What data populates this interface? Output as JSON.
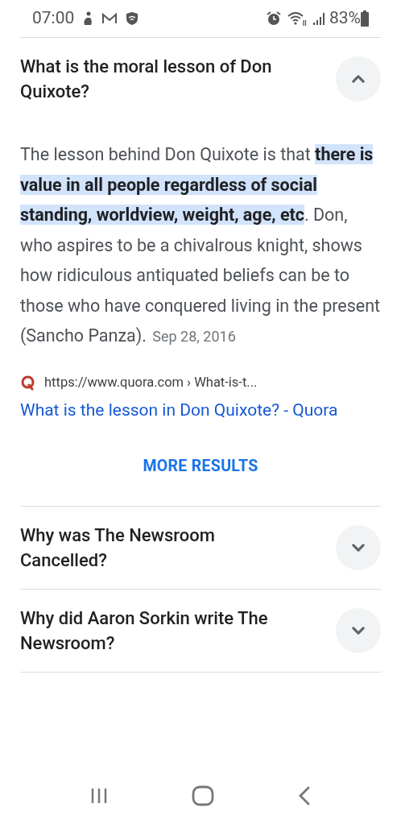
{
  "status_bar": {
    "time": "07:00",
    "battery": "83%"
  },
  "expanded_question": {
    "question": "What is the moral lesson of Don Quixote?",
    "expanded": true,
    "answer": {
      "text_before": "The lesson behind Don Quixote is that ",
      "highlight": "there is value in all people regardless of social standing, worldview, weight, age, etc",
      "text_after": ". Don, who aspires to be a chivalrous knight, shows how ridiculous antiquated beliefs can be to those who have conquered living in the present (Sancho Panza).",
      "date": "Sep 28, 2016"
    },
    "source": {
      "url": "https://www.quora.com › What-is-t...",
      "title": "What is the lesson in Don Quixote? - Quora"
    }
  },
  "more_results": "MORE RESULTS",
  "questions": [
    {
      "question": "Why was The Newsroom Cancelled?",
      "expanded": false
    },
    {
      "question": "Why did Aaron Sorkin write The Newsroom?",
      "expanded": false
    }
  ]
}
